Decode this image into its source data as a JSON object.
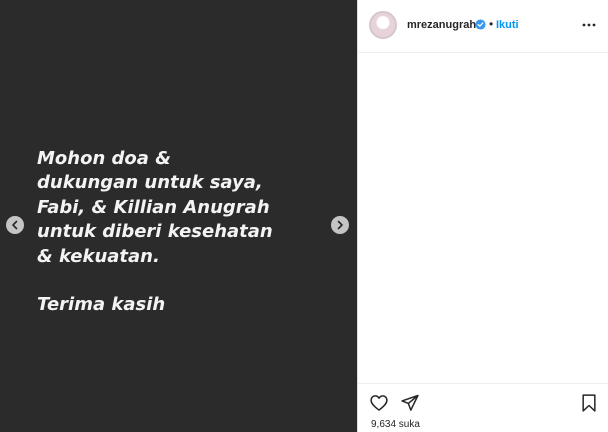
{
  "post": {
    "caption": "Mohon doa &\ndukungan untuk saya,\nFabi, & Killian Anugrah\nuntuk diberi kesehatan\n& kekuatan.\n\nTerima kasih",
    "background_color": "#2b2b2b",
    "text_color": "#f3f3f3"
  },
  "nav": {
    "prev_icon": "chevron-left-icon",
    "next_icon": "chevron-right-icon"
  },
  "header": {
    "username": "mrezanugrah",
    "verified_icon": "verified-badge-icon",
    "separator": "•",
    "follow_label": "Ikuti",
    "more_icon": "more-dots-icon"
  },
  "actions": {
    "like_icon": "heart-icon",
    "share_icon": "paper-plane-icon",
    "save_icon": "bookmark-icon",
    "likes_text": "9,634 suka"
  },
  "colors": {
    "accent": "#0095f6",
    "verified": "#3897f0"
  }
}
